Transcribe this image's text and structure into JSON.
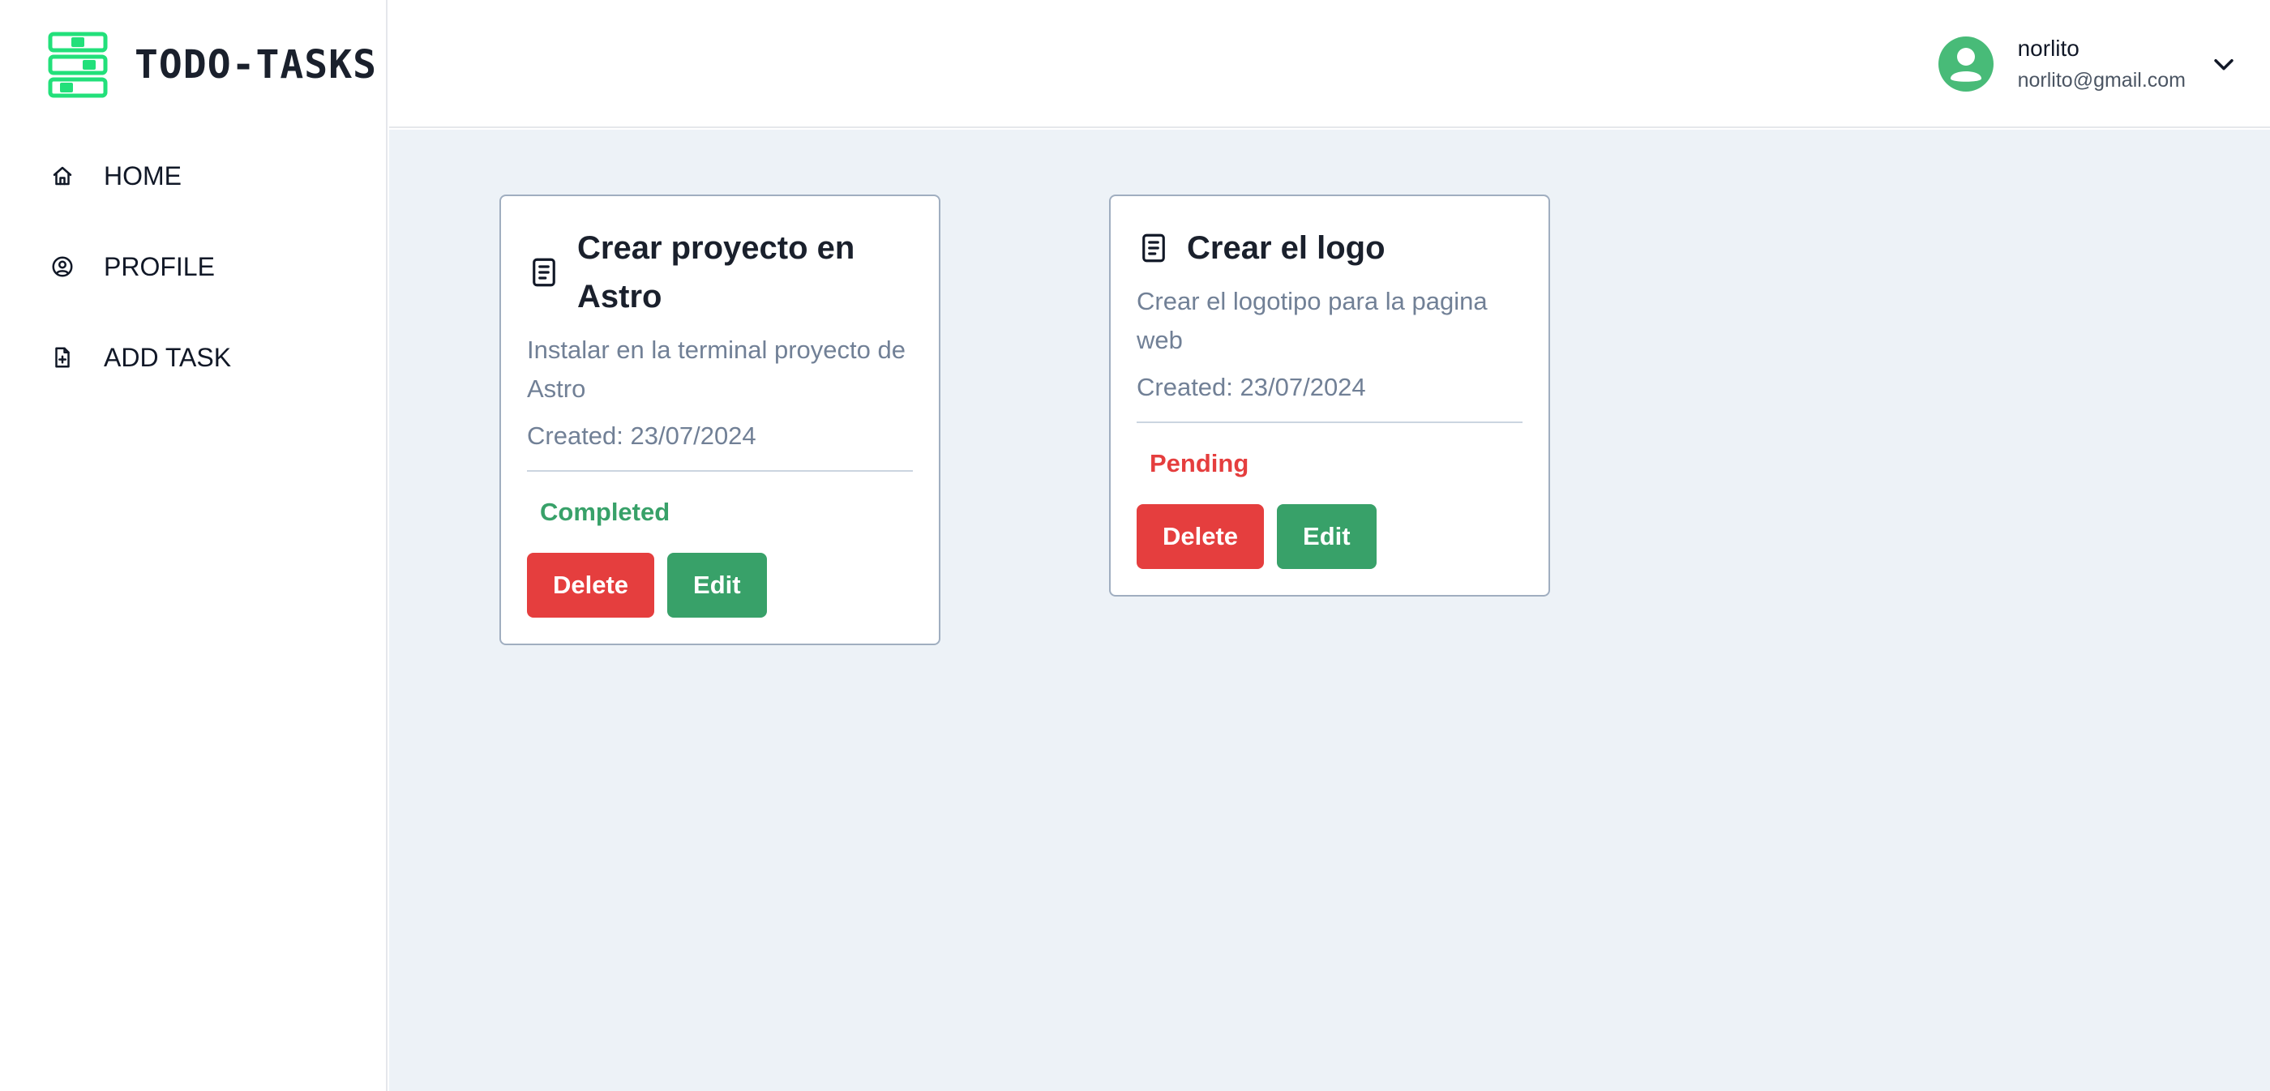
{
  "brand": {
    "name": "TODO-TASKS",
    "accent": "#22e07a"
  },
  "nav": [
    {
      "label": "HOME",
      "icon": "home-icon"
    },
    {
      "label": "PROFILE",
      "icon": "user-circle-icon"
    },
    {
      "label": "ADD TASK",
      "icon": "file-plus-icon"
    }
  ],
  "user": {
    "name": "norlito",
    "email": "norlito@gmail.com",
    "avatar_color": "#48bb78"
  },
  "tasks": [
    {
      "title": "Crear proyecto en Astro",
      "description": "Instalar en la terminal proyecto de Astro",
      "created": "Created: 23/07/2024",
      "status": "Completed",
      "status_color": "#38a169",
      "delete_label": "Delete",
      "edit_label": "Edit"
    },
    {
      "title": "Crear el logo",
      "description": "Crear el logotipo para la pagina web",
      "created": "Created: 23/07/2024",
      "status": "Pending",
      "status_color": "#e53e3e",
      "delete_label": "Delete",
      "edit_label": "Edit"
    }
  ],
  "colors": {
    "delete": "#e53e3e",
    "edit": "#38a169",
    "background": "#edf2f7",
    "card_border": "#a0aec0"
  }
}
